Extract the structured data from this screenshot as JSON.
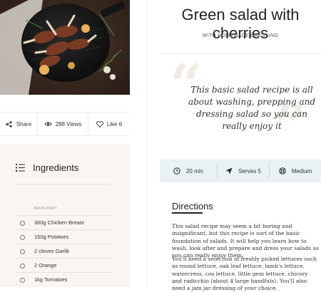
{
  "social": {
    "share_label": "Share",
    "views_label": "288 Views",
    "like_label": "Like 6"
  },
  "ingredients": {
    "heading": "Ingredients",
    "section_label": "MAIN PART",
    "items": [
      "300g Chicken Breast",
      "150g Potatoes",
      "2 cloves Garlik",
      "2 Orange",
      "1kg Tomatoes"
    ]
  },
  "recipe": {
    "title": "Green salad with cherries",
    "subtitle": "WITH HOMEMADE DRESSING",
    "quote": "This basic salad recipe is all about washing, prepping and dressing salad so you can really enjoy it"
  },
  "info": {
    "time": "20 min",
    "serves": "Serves 5",
    "difficulty": "Medium"
  },
  "directions": {
    "heading": "Directions",
    "paragraphs": [
      "This salad recipe may seem a bit boring and insignificant, but this recipe is sort of the basic foundation of salads. It will help you learn how to wash, look after and prepare and dress your salads so you can really enjoy them.",
      "You'll need a selection of freshly picked lettuces such as round lettuce, oak leaf lettuce, lamb's lettuce, watercress, cos lettuce, little gem lettuce, chicory and radicchio (about 4 large handfuls). You'll also need a jam jar dressing of your choice."
    ]
  },
  "colors": {
    "ingredients_bg": "#f8f5f2",
    "info_bar_bg": "#e8f1f4",
    "quote_marks": "#efece7"
  }
}
